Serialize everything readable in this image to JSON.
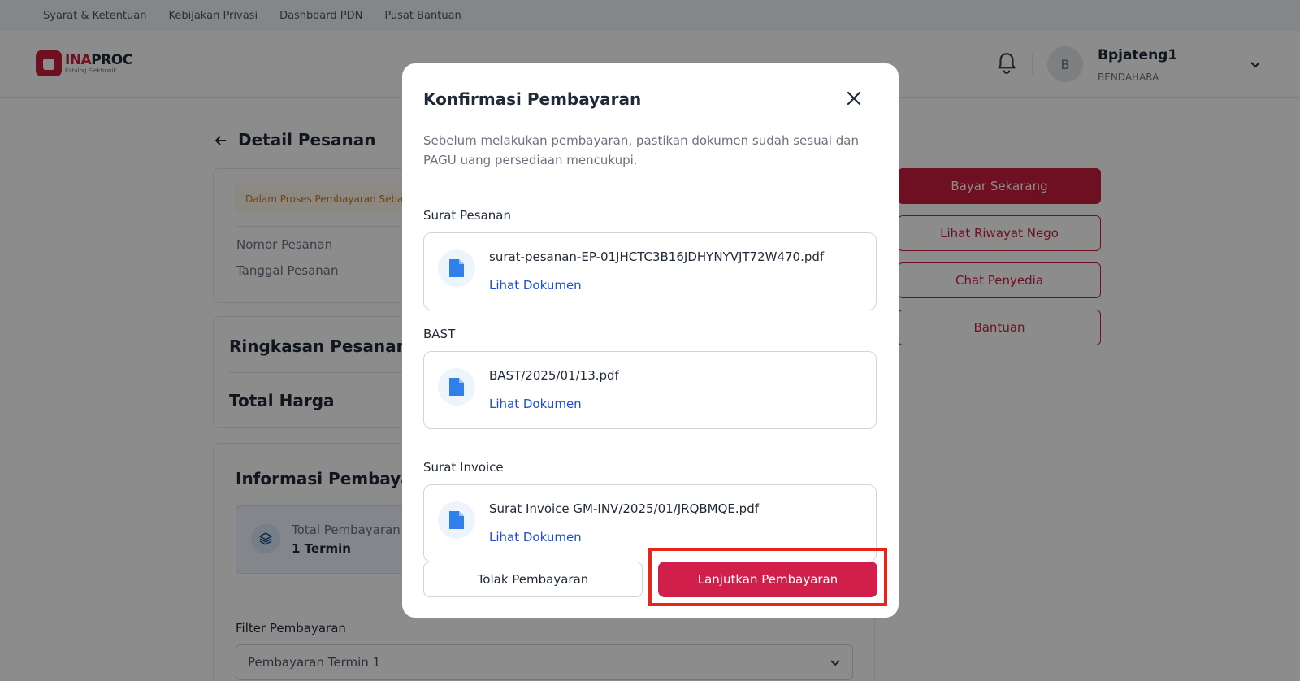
{
  "topbar": {
    "links": [
      "Syarat & Ketentuan",
      "Kebijakan Privasi",
      "Dashboard PDN",
      "Pusat Bantuan"
    ]
  },
  "header": {
    "logo_main": "INA",
    "logo_accent": "PROC",
    "logo_sub": "Katalog Elektronik",
    "avatar_initial": "B",
    "user_name": "Bpjateng1",
    "user_role": "BENDAHARA"
  },
  "page": {
    "title": "Detail Pesanan",
    "status_badge": "Dalam Proses Pembayaran Sebagian",
    "order_number_label": "Nomor Pesanan",
    "order_date_label": "Tanggal Pesanan",
    "summary_title": "Ringkasan Pesanan",
    "total_title": "Total Harga",
    "payment_info_title": "Informasi Pembayaran",
    "total_payment_label": "Total Pembayaran",
    "total_payment_value": "1 Termin",
    "filter_label": "Filter Pembayaran",
    "filter_value": "Pembayaran Termin 1"
  },
  "side_actions": {
    "pay_now": "Bayar Sekarang",
    "nego_history": "Lihat Riwayat Nego",
    "chat_vendor": "Chat Penyedia",
    "help": "Bantuan"
  },
  "modal": {
    "title": "Konfirmasi Pembayaran",
    "description": "Sebelum melakukan pembayaran, pastikan dokumen sudah sesuai dan PAGU uang persediaan mencukupi.",
    "documents": [
      {
        "label": "Surat Pesanan",
        "file": "surat-pesanan-EP-01JHCTC3B16JDHYNYVJT72W470.pdf",
        "link": "Lihat Dokumen"
      },
      {
        "label": "BAST",
        "file": "BAST/2025/01/13.pdf",
        "link": "Lihat Dokumen"
      },
      {
        "label": "Surat Invoice",
        "file": "Surat Invoice GM-INV/2025/01/JRQBMQE.pdf",
        "link": "Lihat Dokumen"
      }
    ],
    "reject_button": "Tolak Pembayaran",
    "continue_button": "Lanjutkan Pembayaran"
  },
  "colors": {
    "brand": "#c81e3c",
    "primary_button": "#d11f4b",
    "link": "#1d4ed8",
    "highlight": "#e8241b"
  }
}
